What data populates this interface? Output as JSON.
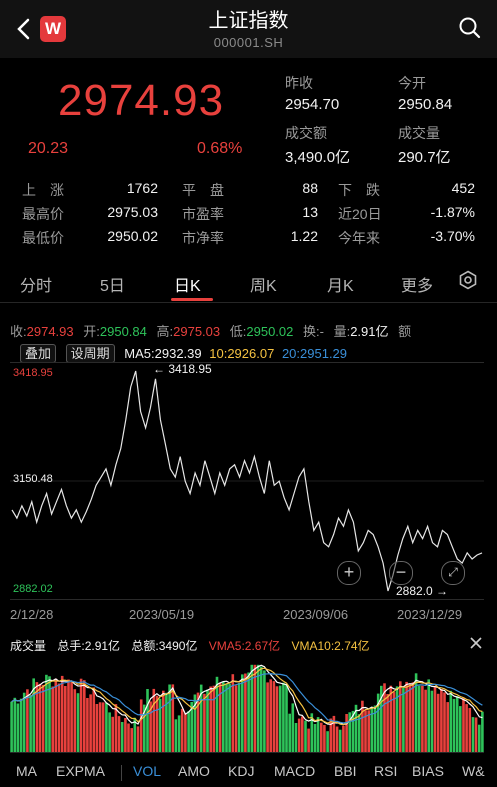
{
  "header": {
    "title": "上证指数",
    "code": "000001.SH",
    "logo_text": "W",
    "back_icon": "chevron-left-icon",
    "search_icon": "search-icon"
  },
  "quote": {
    "price": "2974.93",
    "change": "20.23",
    "change_pct": "0.68%",
    "prev_close_label": "昨收",
    "prev_close": "2954.70",
    "open_label": "今开",
    "open": "2950.84",
    "turnover_label": "成交额",
    "turnover": "3,490.0亿",
    "volume_label": "成交量",
    "volume": "290.7亿"
  },
  "stats": [
    [
      {
        "label": "上　涨",
        "value": "1762"
      },
      {
        "label": "平　盘",
        "value": "88"
      },
      {
        "label": "下　跌",
        "value": "452"
      }
    ],
    [
      {
        "label": "最高价",
        "value": "2975.03"
      },
      {
        "label": "市盈率",
        "value": "13"
      },
      {
        "label": "近20日",
        "value": "-1.87%"
      }
    ],
    [
      {
        "label": "最低价",
        "value": "2950.02"
      },
      {
        "label": "市净率",
        "value": "1.22"
      },
      {
        "label": "今年来",
        "value": "-3.70%"
      }
    ]
  ],
  "tabs": [
    "分时",
    "5日",
    "日K",
    "周K",
    "月K",
    "更多"
  ],
  "active_tab": "日K",
  "infobar": {
    "close_label": "收:",
    "close": "2974.93",
    "open_label": "开:",
    "open": "2950.84",
    "high_label": "高:",
    "high": "2975.03",
    "low_label": "低:",
    "low": "2950.02",
    "turnover_label": "换:-",
    "vol_label": "量:",
    "vol": "2.91亿",
    "cut": "额"
  },
  "chart_controls": {
    "overlay_btn": "叠加",
    "period_btn": "设周期",
    "ma5": "MA5:2932.39",
    "ma10": "10:2926.07",
    "ma20": "20:2951.29"
  },
  "chart": {
    "y_top": "3418.95",
    "y_mid": "3150.48",
    "y_bot": "2882.02",
    "peak_label": "← 3418.95",
    "trough_label": "2882.0 →",
    "dates": [
      "2/12/28",
      "2023/05/19",
      "2023/09/06",
      "2023/12/29"
    ]
  },
  "volume_panel": {
    "title": "成交量",
    "total_hand": "总手:2.91亿",
    "amount": "总额:3490亿",
    "vma5": "VMA5:2.67亿",
    "vma10": "VMA10:2.74亿"
  },
  "indicators": [
    "MA",
    "EXPMA",
    "VOL",
    "AMO",
    "KDJ",
    "MACD",
    "BBI",
    "RSI",
    "BIAS",
    "W&"
  ],
  "active_indicator": "VOL",
  "chart_data": {
    "type": "line",
    "ylim": [
      2882.02,
      3418.95
    ],
    "x_labels": [
      "2/12/28",
      "2023/05/19",
      "2023/09/06",
      "2023/12/29"
    ],
    "series": [
      {
        "values": [
          3080,
          3060,
          3090,
          3065,
          3100,
          3050,
          3090,
          3120,
          3070,
          3100,
          3130,
          3090,
          3060,
          3080,
          3050,
          3075,
          3105,
          3140,
          3160,
          3180,
          3140,
          3190,
          3230,
          3300,
          3380,
          3418.95,
          3320,
          3280,
          3330,
          3400,
          3300,
          3240,
          3180,
          3160,
          3210,
          3150,
          3120,
          3170,
          3140,
          3200,
          3160,
          3120,
          3170,
          3140,
          3180,
          3190,
          3160,
          3200,
          3170,
          3210,
          3160,
          3120,
          3200,
          3140,
          3150,
          3110,
          3080,
          3120,
          3160,
          3180,
          3100,
          3030,
          3050,
          3000,
          2990,
          3020,
          3060,
          3040,
          3080,
          3050,
          2980,
          3000,
          3030,
          3020,
          2990,
          2950,
          2882.0,
          2920,
          2970,
          3010,
          3040,
          3000,
          3030,
          3010,
          3040,
          3000,
          2990,
          3030,
          3020,
          2990,
          2960,
          2950,
          2975,
          2960,
          2970,
          2974.93
        ]
      }
    ]
  },
  "colors": {
    "up": "#e8413d",
    "down": "#2ec35a",
    "ma5": "#ffffff",
    "ma10": "#f5c242",
    "ma20": "#3a8fd8"
  }
}
